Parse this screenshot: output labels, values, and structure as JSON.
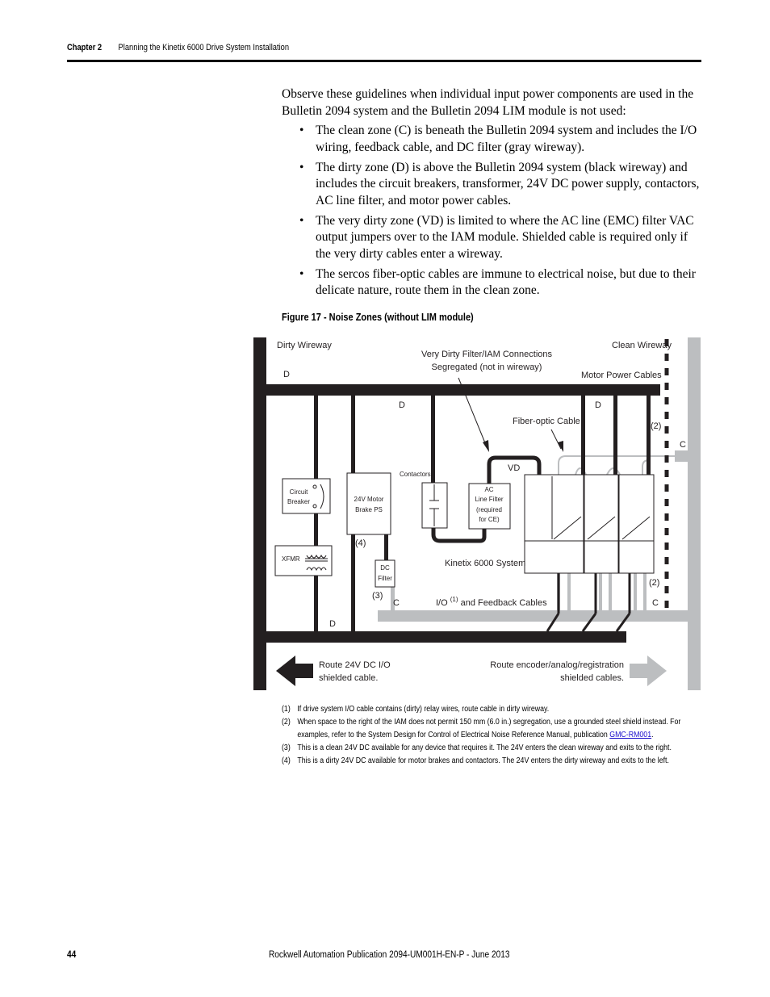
{
  "header": {
    "chapter": "Chapter 2",
    "title": "Planning the Kinetix 6000 Drive System Installation"
  },
  "intro": "Observe these guidelines when individual input power components are used in the Bulletin 2094 system and the Bulletin 2094 LIM module is not used:",
  "bullets": [
    "The clean zone (C) is beneath the Bulletin 2094 system and includes the I/O wiring, feedback cable, and DC filter (gray wireway).",
    "The dirty zone (D) is above the Bulletin 2094 system (black wireway) and includes the circuit breakers, transformer, 24V DC power supply, contactors, AC line filter, and motor power cables.",
    "The very dirty zone (VD) is limited to where the AC line (EMC) filter VAC output jumpers over to the IAM module. Shielded cable is required only if the very dirty cables enter a wireway.",
    "The sercos fiber-optic cables are immune to electrical noise, but due to their delicate nature, route them in the clean zone."
  ],
  "figure": {
    "caption": "Figure 17 - Noise Zones (without LIM module)",
    "dirty_wireway": "Dirty Wireway",
    "clean_wireway": "Clean Wireway",
    "vd_conn_1": "Very Dirty Filter/IAM Connections",
    "vd_conn_2": "Segregated (not in wireway)",
    "motor_power": "Motor Power Cables",
    "fiber": "Fiber-optic Cable",
    "d": "D",
    "c": "C",
    "vd": "VD",
    "n2": "(2)",
    "n3": "(3)",
    "n4": "(4)",
    "cb1": "Circuit",
    "cb2": "Breaker",
    "xfmr": "XFMR",
    "ps1": "24V Motor",
    "ps2": "Brake PS",
    "dc1": "DC",
    "dc2": "Filter",
    "contactors": "Contactors",
    "ac1": "AC",
    "ac2": "Line Filter",
    "ac3": "(required",
    "ac4": "for CE)",
    "kinetix": "Kinetix 6000 System",
    "io_1": "I/O",
    "io_sup": "(1)",
    "io_2": "and Feedback Cables",
    "left_1": "Route 24V DC I/O",
    "left_2": "shielded cable.",
    "right_1": "Route encoder/analog/registration",
    "right_2": "shielded cables.",
    "colors": {
      "dirty": "#231f20",
      "clean": "#bcbec0"
    }
  },
  "notes": [
    {
      "n": "(1)",
      "text": "If drive system I/O cable contains (dirty) relay wires, route cable in dirty wireway."
    },
    {
      "n": "(2)",
      "text": "When space to the right of the IAM does not permit 150 mm (6.0 in.) segregation, use a grounded steel shield instead. For examples, refer to the System Design for Control of Electrical Noise Reference Manual, publication ",
      "link": "GMC-RM001",
      "after": "."
    },
    {
      "n": "(3)",
      "text": "This is a clean 24V DC available for any device that requires it. The 24V enters the clean wireway and exits to the right."
    },
    {
      "n": "(4)",
      "text": "This is a dirty 24V DC available for motor brakes and contactors. The 24V enters the dirty wireway and exits to the left."
    }
  ],
  "footer": {
    "page": "44",
    "publication": "Rockwell Automation Publication 2094-UM001H-EN-P - June 2013"
  }
}
